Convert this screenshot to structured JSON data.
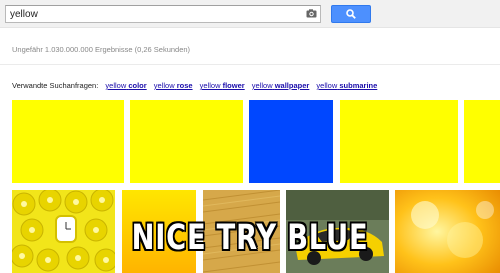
{
  "search": {
    "query": "yellow",
    "camera_icon": "camera-icon",
    "button_icon": "magnifier-icon"
  },
  "stats": "Ungefähr 1.030.000.000 Ergebnisse (0,26 Sekunden)",
  "related": {
    "label": "Verwandte Suchanfragen:",
    "items": [
      {
        "plain": "yellow",
        "bold": "color"
      },
      {
        "plain": "yellow",
        "bold": "rose"
      },
      {
        "plain": "yellow",
        "bold": "flower"
      },
      {
        "plain": "yellow",
        "bold": "wallpaper"
      },
      {
        "plain": "yellow",
        "bold": "submarine"
      }
    ]
  },
  "swatches": [
    "#ffff00",
    "#ffff00",
    "#0047ff",
    "#ffff00",
    "#ffff00"
  ],
  "photos": [
    "yellow-donuts-watch",
    "yellow-gradient",
    "yellow-texture",
    "yellow-sports-car",
    "yellow-bokeh"
  ],
  "caption": "NICE TRY BLUE",
  "colors": {
    "accent": "#4d90fe",
    "link": "#1a0dab"
  }
}
